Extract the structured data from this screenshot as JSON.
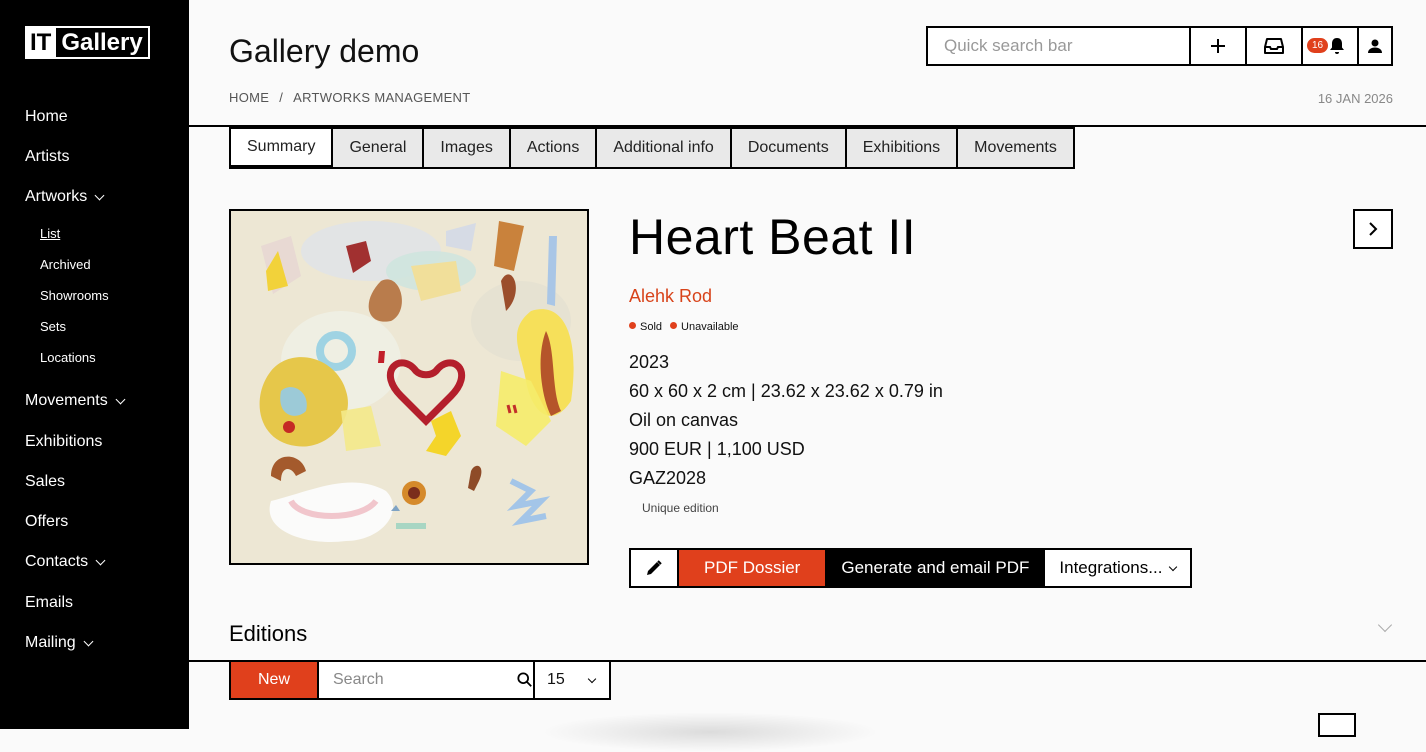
{
  "brand": {
    "logo_left": "IT",
    "logo_right": "Gallery"
  },
  "sidebar": {
    "items": [
      {
        "label": "Home"
      },
      {
        "label": "Artists"
      },
      {
        "label": "Artworks"
      },
      {
        "label": "Movements"
      },
      {
        "label": "Exhibitions"
      },
      {
        "label": "Sales"
      },
      {
        "label": "Offers"
      },
      {
        "label": "Contacts"
      },
      {
        "label": "Emails"
      },
      {
        "label": "Mailing"
      }
    ],
    "artworks_sub": [
      {
        "label": "List",
        "active": true
      },
      {
        "label": "Archived"
      },
      {
        "label": "Showrooms"
      },
      {
        "label": "Sets"
      },
      {
        "label": "Locations"
      }
    ]
  },
  "header": {
    "title": "Gallery demo",
    "breadcrumb": [
      "HOME",
      "ARTWORKS MANAGEMENT"
    ],
    "breadcrumb_sep": "/",
    "date": "16 JAN 2026",
    "search_placeholder": "Quick search bar",
    "notification_count": "16"
  },
  "tabs": [
    "Summary",
    "General",
    "Images",
    "Actions",
    "Additional info",
    "Documents",
    "Exhibitions",
    "Movements"
  ],
  "artwork": {
    "title": "Heart Beat II",
    "artist": "Alehk Rod",
    "statuses": [
      "Sold",
      "Unavailable"
    ],
    "year": "2023",
    "dimensions": "60 x 60 x 2 cm | 23.62 x 23.62 x 0.79 in",
    "medium": "Oil on canvas",
    "price": "900 EUR | 1,100 USD",
    "reference": "GAZ2028",
    "edition": "Unique edition"
  },
  "actions": {
    "pdf": "PDF Dossier",
    "generate": "Generate and email PDF",
    "integrations": "Integrations..."
  },
  "editions": {
    "title": "Editions",
    "new_label": "New",
    "search_placeholder": "Search",
    "per_page": "15"
  },
  "colors": {
    "accent": "#e0401c",
    "sidebar_bg": "#000000"
  }
}
